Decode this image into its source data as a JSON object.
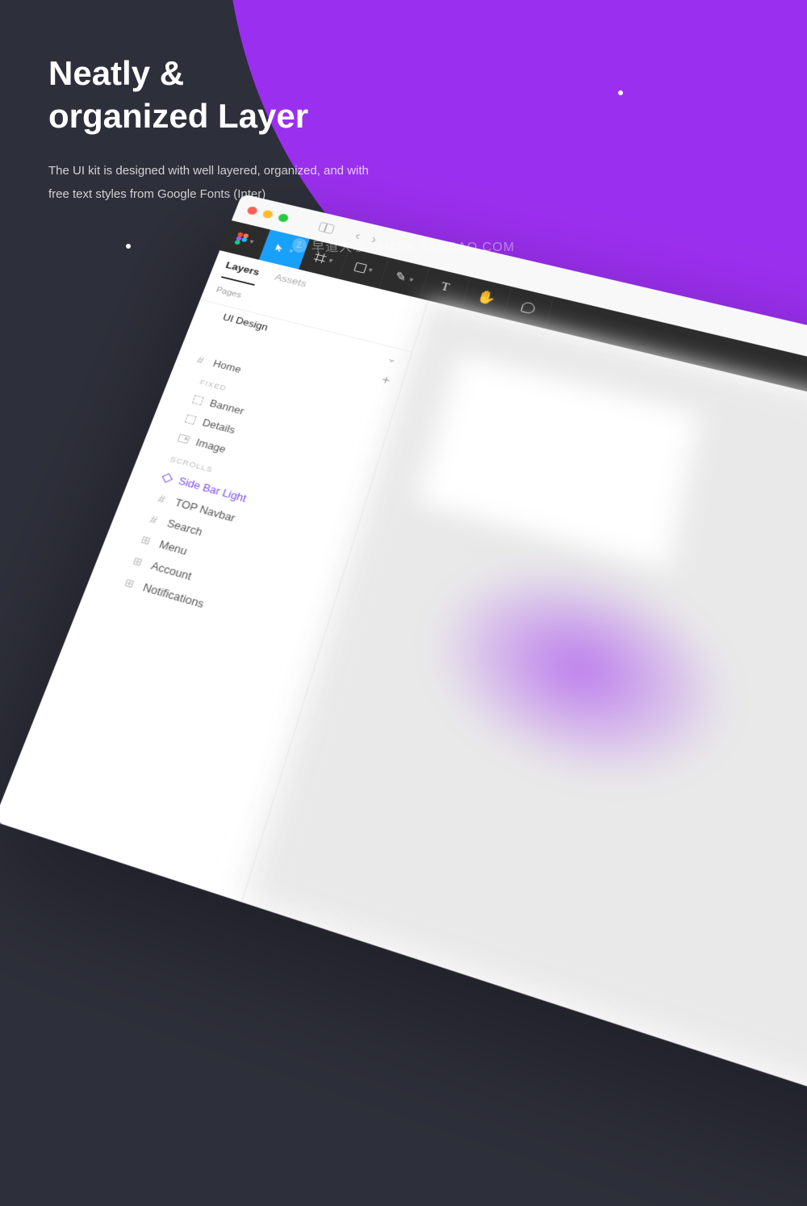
{
  "hero": {
    "title_line1": "Neatly &",
    "title_line2": "organized Layer",
    "description": "The UI kit is designed with well layered, organized, and with free text styles from Google Fonts (Inter)"
  },
  "watermark": "早道大咖 IAMDK.TAOBAO.COM",
  "figma": {
    "tabs": {
      "layers": "Layers",
      "assets": "Assets"
    },
    "pages_label": "Pages",
    "page_name": "UI Design",
    "sections": {
      "fixed": "FIXED",
      "scrolls": "SCROLLS"
    },
    "layers": {
      "home": "Home",
      "banner": "Banner",
      "details": "Details",
      "image": "Image",
      "sidebar_light": "Side Bar Light",
      "top_navbar": "TOP Navbar",
      "search": "Search",
      "menu": "Menu",
      "account": "Account",
      "notifications": "Notifications"
    }
  },
  "colors": {
    "accent_purple": "#9b2fef",
    "figma_blue": "#18a0fb",
    "selection_purple": "#7b4ff0"
  }
}
